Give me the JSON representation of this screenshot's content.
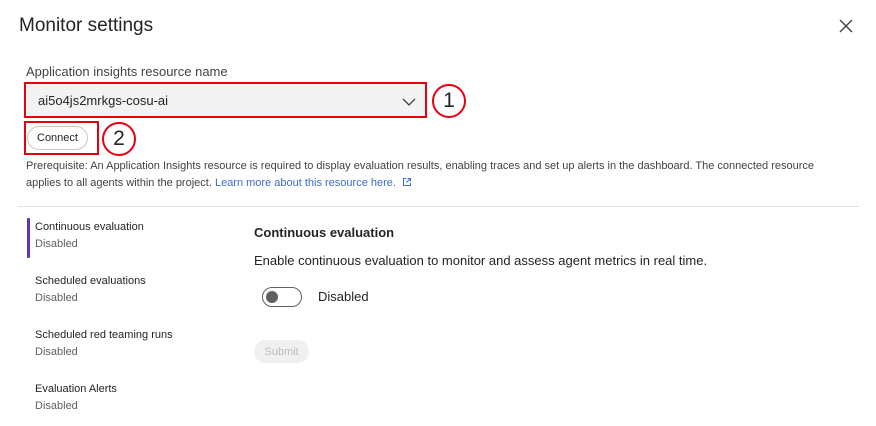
{
  "dialog": {
    "title": "Monitor settings",
    "close_icon": "close-icon"
  },
  "resource": {
    "label": "Application insights resource name",
    "selected": "ai5o4js2mrkgs-cosu-ai",
    "connect_label": "Connect",
    "prereq_text": "Prerequisite: An Application Insights resource is required to display evaluation results, enabling traces and set up alerts in the dashboard. The connected resource applies to all agents within the project.",
    "learn_more": "Learn more about this resource here.",
    "link_color": "#3b6ccf"
  },
  "callouts": {
    "one": "1",
    "two": "2",
    "color": "#e8000f"
  },
  "nav": [
    {
      "title": "Continuous evaluation",
      "status": "Disabled",
      "active": true
    },
    {
      "title": "Scheduled evaluations",
      "status": "Disabled",
      "active": false
    },
    {
      "title": "Scheduled red teaming runs",
      "status": "Disabled",
      "active": false
    },
    {
      "title": "Evaluation Alerts",
      "status": "Disabled",
      "active": false
    }
  ],
  "nav_accent": "#6b2fa8",
  "panel": {
    "title": "Continuous evaluation",
    "description": "Enable continuous evaluation to monitor and assess agent metrics in real time.",
    "toggle_label": "Disabled",
    "toggle_on": false,
    "submit_label": "Submit"
  }
}
